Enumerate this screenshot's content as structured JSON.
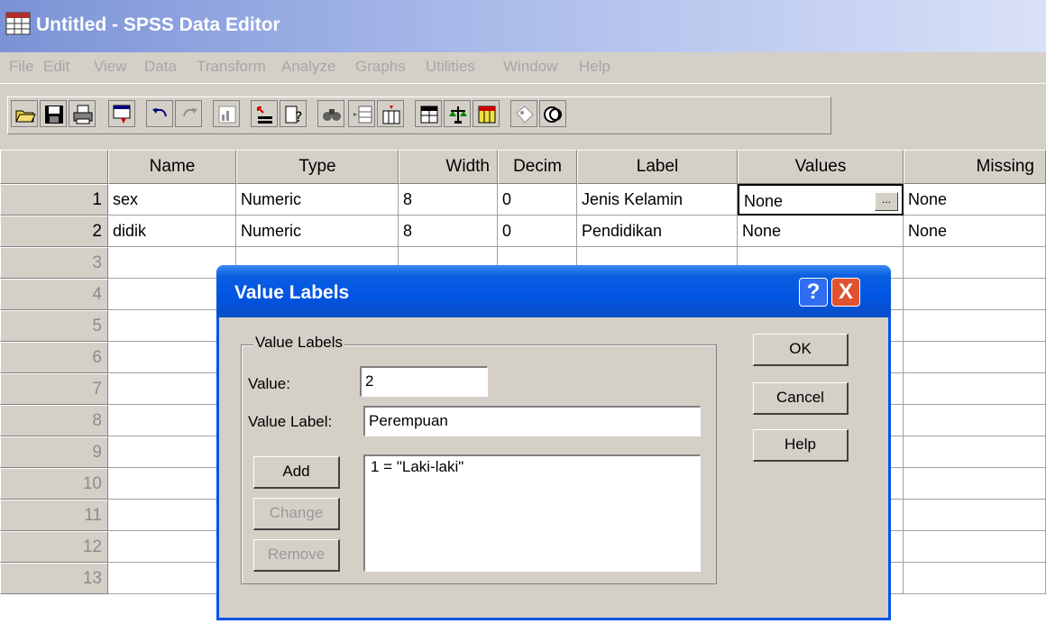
{
  "window": {
    "title": "Untitled - SPSS Data Editor"
  },
  "menu": [
    "File",
    "Edit",
    "View",
    "Data",
    "Transform",
    "Analyze",
    "Graphs",
    "Utilities",
    "Window",
    "Help"
  ],
  "toolbar": {
    "icons": [
      "open-folder-icon",
      "save-icon",
      "print-icon",
      "dialog-recall-icon",
      "undo-icon",
      "redo-icon",
      "goto-chart-icon",
      "goto-case-icon",
      "variables-icon",
      "find-icon",
      "insert-cases-icon",
      "insert-variable-icon",
      "split-file-icon",
      "weight-cases-icon",
      "select-cases-icon",
      "value-labels-icon",
      "use-sets-icon"
    ]
  },
  "grid": {
    "columns": [
      "Name",
      "Type",
      "Width",
      "Decim",
      "Label",
      "Values",
      "Missing"
    ],
    "rows": [
      {
        "num": "1",
        "name": "sex",
        "type": "Numeric",
        "width": "8",
        "decim": "0",
        "label": "Jenis Kelamin",
        "values": "None",
        "missing": "None"
      },
      {
        "num": "2",
        "name": "didik",
        "type": "Numeric",
        "width": "8",
        "decim": "0",
        "label": "Pendidikan",
        "values": "None",
        "missing": "None"
      }
    ],
    "empty_rows": [
      "3",
      "4",
      "5",
      "6",
      "7",
      "8",
      "9",
      "10",
      "11",
      "12",
      "13"
    ],
    "ellipsis": "..."
  },
  "dialog": {
    "title": "Value Labels",
    "help_glyph": "?",
    "close_glyph": "X",
    "group_label": "Value Labels",
    "value_label": "Value:",
    "value": "2",
    "value_label_label": "Value Label:",
    "value_label_value": "Perempuan",
    "add": "Add",
    "change": "Change",
    "remove": "Remove",
    "list_items": [
      "1 = \"Laki-laki\""
    ],
    "ok": "OK",
    "cancel": "Cancel",
    "help": "Help"
  }
}
